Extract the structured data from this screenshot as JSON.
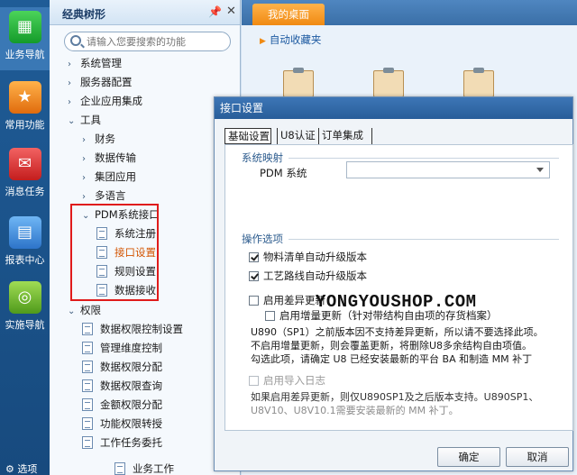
{
  "rail": {
    "items": [
      {
        "label": "业务导航",
        "icon": "grid-icon"
      },
      {
        "label": "常用功能",
        "icon": "star-icon"
      },
      {
        "label": "消息任务",
        "icon": "mail-icon"
      },
      {
        "label": "报表中心",
        "icon": "chart-icon"
      },
      {
        "label": "实施导航",
        "icon": "compass-icon"
      }
    ],
    "more_label": "选项"
  },
  "tree": {
    "title": "经典树形",
    "search_placeholder": "请输入您要搜索的功能",
    "nodes": [
      {
        "label": "系统管理",
        "arrow": "›"
      },
      {
        "label": "服务器配置",
        "arrow": "›"
      },
      {
        "label": "企业应用集成",
        "arrow": "›"
      },
      {
        "label": "工具",
        "arrow": "⌄"
      },
      {
        "label": "财务",
        "arrow": "›"
      },
      {
        "label": "数据传输",
        "arrow": "›"
      },
      {
        "label": "集团应用",
        "arrow": "›"
      },
      {
        "label": "多语言",
        "arrow": "›"
      },
      {
        "label": "PDM系统接口",
        "arrow": "⌄"
      },
      {
        "label": "系统注册"
      },
      {
        "label": "接口设置"
      },
      {
        "label": "规则设置"
      },
      {
        "label": "数据接收"
      },
      {
        "label": "权限",
        "arrow": "⌄"
      },
      {
        "label": "数据权限控制设置"
      },
      {
        "label": "管理维度控制"
      },
      {
        "label": "数据权限分配"
      },
      {
        "label": "数据权限查询"
      },
      {
        "label": "金额权限分配"
      },
      {
        "label": "功能权限转授"
      },
      {
        "label": "工作任务委托"
      },
      {
        "label": "业务工作"
      }
    ]
  },
  "desktop": {
    "tab": "我的桌面",
    "favorites": "自动收藏夹"
  },
  "dialog": {
    "title": "接口设置",
    "tabs": [
      "基础设置",
      "U8认证",
      "订单集成"
    ],
    "sys_map_title": "系统映射",
    "pdm_label": "PDM 系统",
    "pdm_value": "",
    "ops_title": "操作选项",
    "opt1": "物料清单自动升级版本",
    "opt2": "工艺路线自动升级版本",
    "opt3": "启用差异更新",
    "opt4": "启用增量更新（针对带结构自由项的存货档案）",
    "note1": "U890（SP1）之前版本因不支持差异更新，所以请不要选择此项。",
    "note2": "不启用增量更新，则会覆盖更新，将删除U8多余结构自由项值。",
    "note3": "勾选此项，请确定 U8 已经安装最新的平台 BA 和制造 MM 补丁",
    "opt5": "启用导入日志",
    "note4": "如果启用差异更新，则仅U890SP1及之后版本支持。U890SP1、",
    "note5": "U8V10、U8V10.1需要安装最新的 MM 补丁。",
    "watermark": "YONGYOUSHOP.COM",
    "ok": "确定",
    "cancel": "取消"
  }
}
